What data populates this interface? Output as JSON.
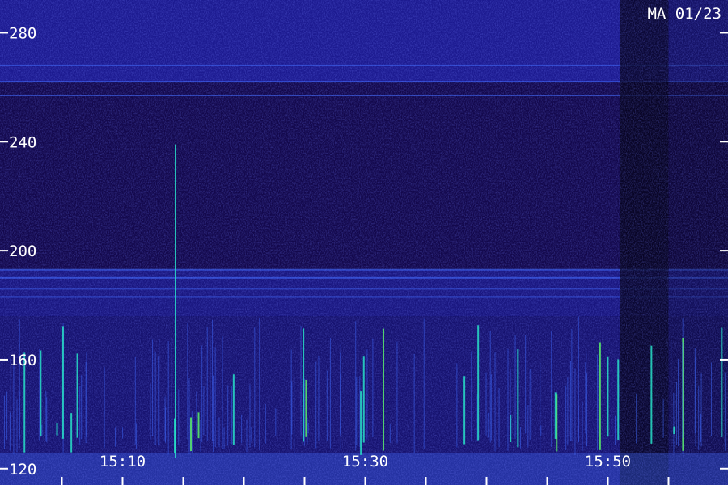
{
  "chart_data": {
    "type": "heatmap",
    "title": "MA 01/23",
    "xlabel": "",
    "ylabel": "",
    "y_ticks": [
      120,
      160,
      200,
      240,
      280
    ],
    "ylim": [
      114,
      292
    ],
    "x_ticks": [
      "15:10",
      "15:30",
      "15:50"
    ],
    "x_tick_minutes": [
      10,
      30,
      50
    ],
    "xlim_minutes": [
      -0.1,
      59.9
    ],
    "x_minor_step_minutes": 5,
    "colors": {
      "background": "#0b0638",
      "low": "#170a55",
      "mid": "#2b2bd8",
      "high": "#3f6cff",
      "peak": "#28e0c8",
      "burst": "#5af06a",
      "dark_band": "#050318",
      "text": "#ffffff"
    },
    "bright_bands_y": [
      268,
      262,
      257,
      193,
      190,
      186,
      183
    ],
    "burst_band_y": [
      125,
      176
    ],
    "quiet_region_minutes": [
      51,
      55
    ]
  }
}
